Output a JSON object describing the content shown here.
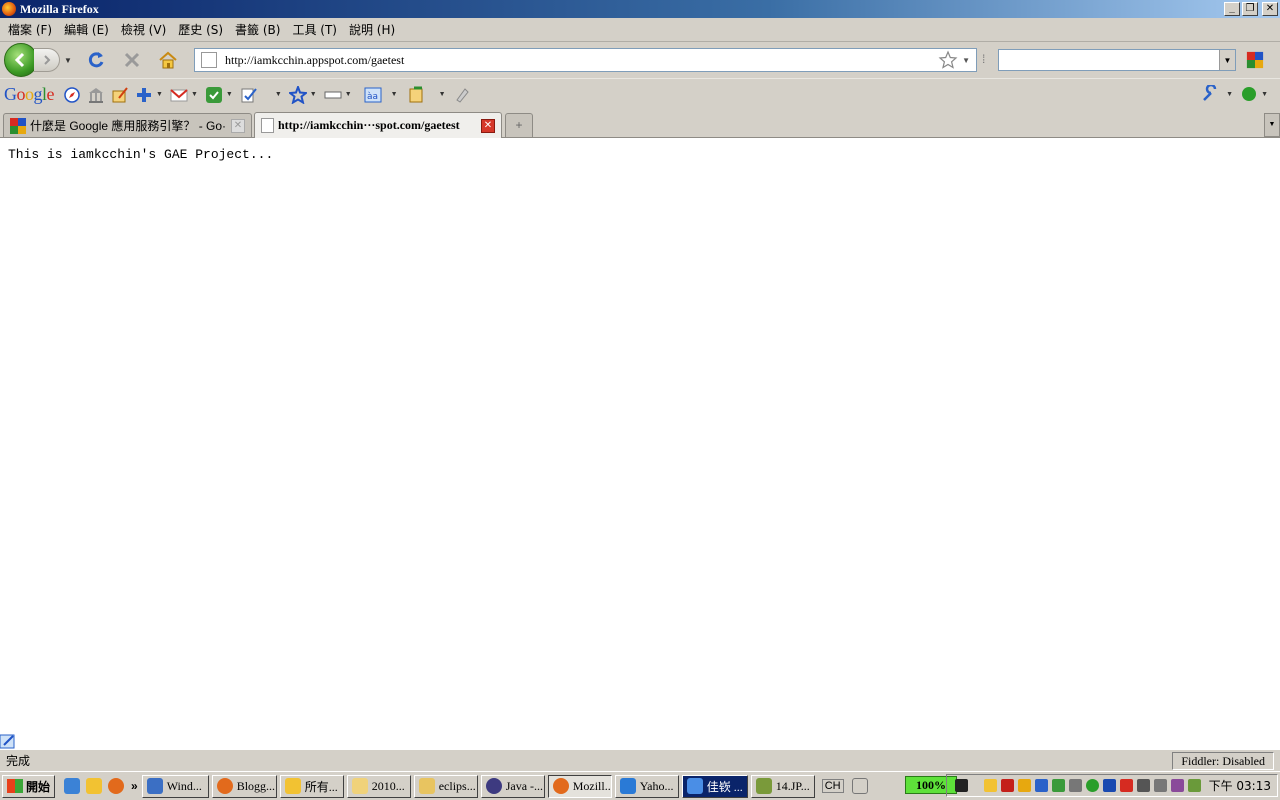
{
  "window": {
    "title": "Mozilla Firefox"
  },
  "menu": [
    {
      "label": "檔案 (F)"
    },
    {
      "label": "編輯 (E)"
    },
    {
      "label": "檢視 (V)"
    },
    {
      "label": "歷史 (S)"
    },
    {
      "label": "書籤 (B)"
    },
    {
      "label": "工具 (T)"
    },
    {
      "label": "說明 (H)"
    }
  ],
  "navbar": {
    "url": "http://iamkcchin.appspot.com/gaetest",
    "search_value": ""
  },
  "google_toolbar": {
    "logo": "Google"
  },
  "tabs": [
    {
      "label": "什麼是 Google 應用服務引擎？ - Go···",
      "active": false
    },
    {
      "label": "http://iamkcchin···spot.com/gaetest",
      "active": true
    }
  ],
  "content": {
    "text": "This is iamkcchin's GAE Project..."
  },
  "status": {
    "text": "完成",
    "fiddler": "Fiddler: Disabled"
  },
  "taskbar": {
    "start": "開始",
    "more": "»",
    "buttons": [
      {
        "label": "Wind...",
        "color": "#3b6fc4"
      },
      {
        "label": "Blogg...",
        "color": "#e26a1c"
      },
      {
        "label": "所有...",
        "color": "#f2c232"
      },
      {
        "label": "2010...",
        "color": "#f0d27a"
      },
      {
        "label": "eclips...",
        "color": "#e8c460"
      },
      {
        "label": "Java -...",
        "color": "#3d3a80"
      },
      {
        "label": "Mozill...",
        "color": "#e26a1c"
      },
      {
        "label": "Yaho...",
        "color": "#2a7ad6"
      },
      {
        "label": "佳嵚 ...",
        "color": "#4a8ee6"
      },
      {
        "label": "14.JP...",
        "color": "#7a9a3a"
      }
    ],
    "lang": "CH",
    "battery": "100%",
    "clock": "下午 03:13"
  }
}
